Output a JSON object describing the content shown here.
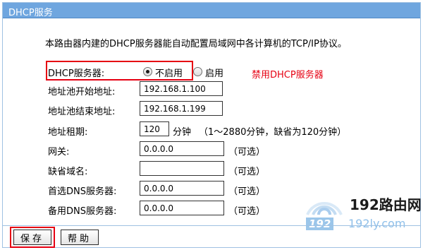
{
  "header": {
    "title": "DHCP服务"
  },
  "description": "本路由器内建的DHCP服务器能自动配置局域网中各计算机的TCP/IP协议。",
  "dhcp_server": {
    "label": "DHCP服务器:",
    "options": [
      {
        "label": "不启用",
        "selected": true
      },
      {
        "label": "启用",
        "selected": false
      }
    ],
    "annotation": "禁用DHCP服务器",
    "annotation_color": "#e60012"
  },
  "fields": {
    "pool_start": {
      "label": "地址池开始地址:",
      "value": "192.168.1.100"
    },
    "pool_end": {
      "label": "地址池结束地址:",
      "value": "192.168.1.199"
    },
    "lease": {
      "label": "地址租期:",
      "value": "120",
      "unit": "分钟",
      "hint": "（1～2880分钟，缺省为120分钟）"
    },
    "gateway": {
      "label": "网关:",
      "value": "0.0.0.0",
      "hint": "（可选）"
    },
    "domain": {
      "label": "缺省域名:",
      "value": "",
      "hint": "（可选）"
    },
    "primary_dns": {
      "label": "首选DNS服务器:",
      "value": "0.0.0.0",
      "hint": "（可选）"
    },
    "secondary_dns": {
      "label": "备用DNS服务器:",
      "value": "0.0.0.0",
      "hint": "（可选）"
    }
  },
  "buttons": {
    "save": "保存",
    "help": "帮助"
  },
  "watermark": {
    "brand": "192路由网",
    "badge": "192",
    "domain": "192ly.com"
  },
  "colors": {
    "title_bar": "#6fa6df",
    "highlight": "#e60012",
    "border": "#9fc1e2"
  }
}
